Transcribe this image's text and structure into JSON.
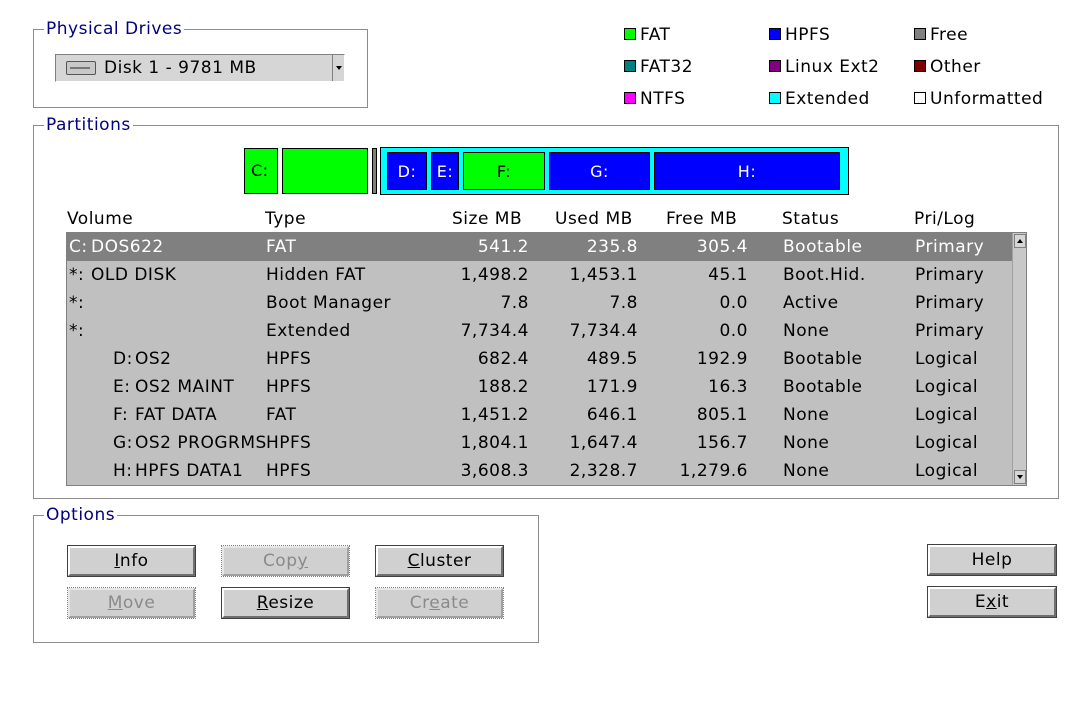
{
  "physical_drives": {
    "title": "Physical Drives",
    "selected_disk": "Disk 1 - 9781 MB"
  },
  "legend": {
    "fat": {
      "label": "FAT",
      "color": "#00ff00"
    },
    "fat32": {
      "label": "FAT32",
      "color": "#008080"
    },
    "ntfs": {
      "label": "NTFS",
      "color": "#ff00ff"
    },
    "hpfs": {
      "label": "HPFS",
      "color": "#0000ff"
    },
    "linux_ext2": {
      "label": "Linux Ext2",
      "color": "#800080"
    },
    "extended": {
      "label": "Extended",
      "color": "#00ffff"
    },
    "free": {
      "label": "Free",
      "color": "#808080"
    },
    "other": {
      "label": "Other",
      "color": "#800000"
    },
    "unformatted": {
      "label": "Unformatted",
      "color": "#ffffff"
    }
  },
  "partitions": {
    "title": "Partitions",
    "bar": {
      "c": "C:",
      "d": "D:",
      "e": "E:",
      "f": "F:",
      "g": "G:",
      "h": "H:"
    },
    "columns": {
      "volume": "Volume",
      "type": "Type",
      "size": "Size MB",
      "used": "Used MB",
      "free": "Free MB",
      "status": "Status",
      "prilog": "Pri/Log"
    },
    "rows": [
      {
        "letter": "C:",
        "name": "DOS622",
        "type": "FAT",
        "size": "541.2",
        "used": "235.8",
        "free": "305.4",
        "status": "Bootable",
        "prilog": "Primary"
      },
      {
        "letter": "*:",
        "name": "OLD DISK",
        "type": "Hidden FAT",
        "size": "1,498.2",
        "used": "1,453.1",
        "free": "45.1",
        "status": "Boot.Hid.",
        "prilog": "Primary"
      },
      {
        "letter": "*:",
        "name": "",
        "type": "Boot Manager",
        "size": "7.8",
        "used": "7.8",
        "free": "0.0",
        "status": "Active",
        "prilog": "Primary"
      },
      {
        "letter": "*:",
        "name": "",
        "type": "Extended",
        "size": "7,734.4",
        "used": "7,734.4",
        "free": "0.0",
        "status": "None",
        "prilog": "Primary"
      },
      {
        "letter": "D:",
        "name": "OS2",
        "type": "HPFS",
        "size": "682.4",
        "used": "489.5",
        "free": "192.9",
        "status": "Bootable",
        "prilog": "Logical"
      },
      {
        "letter": "E:",
        "name": "OS2 MAINT",
        "type": "HPFS",
        "size": "188.2",
        "used": "171.9",
        "free": "16.3",
        "status": "Bootable",
        "prilog": "Logical"
      },
      {
        "letter": "F:",
        "name": "FAT DATA",
        "type": "FAT",
        "size": "1,451.2",
        "used": "646.1",
        "free": "805.1",
        "status": "None",
        "prilog": "Logical"
      },
      {
        "letter": "G:",
        "name": "OS2 PROGRMS",
        "type": "HPFS",
        "size": "1,804.1",
        "used": "1,647.4",
        "free": "156.7",
        "status": "None",
        "prilog": "Logical"
      },
      {
        "letter": "H:",
        "name": "HPFS DATA1",
        "type": "HPFS",
        "size": "3,608.3",
        "used": "2,328.7",
        "free": "1,279.6",
        "status": "None",
        "prilog": "Logical"
      }
    ]
  },
  "options": {
    "title": "Options",
    "info": {
      "pre": "",
      "key": "I",
      "post": "nfo"
    },
    "copy": {
      "pre": "Cop",
      "key": "y",
      "post": ""
    },
    "cluster": {
      "pre": "",
      "key": "C",
      "post": "luster"
    },
    "move": {
      "pre": "",
      "key": "M",
      "post": "ove"
    },
    "resize": {
      "pre": "",
      "key": "R",
      "post": "esize"
    },
    "create": {
      "pre": "Cr",
      "key": "e",
      "post": "ate"
    }
  },
  "side_buttons": {
    "help": "Help",
    "exit": {
      "pre": "E",
      "key": "x",
      "post": "it"
    }
  }
}
